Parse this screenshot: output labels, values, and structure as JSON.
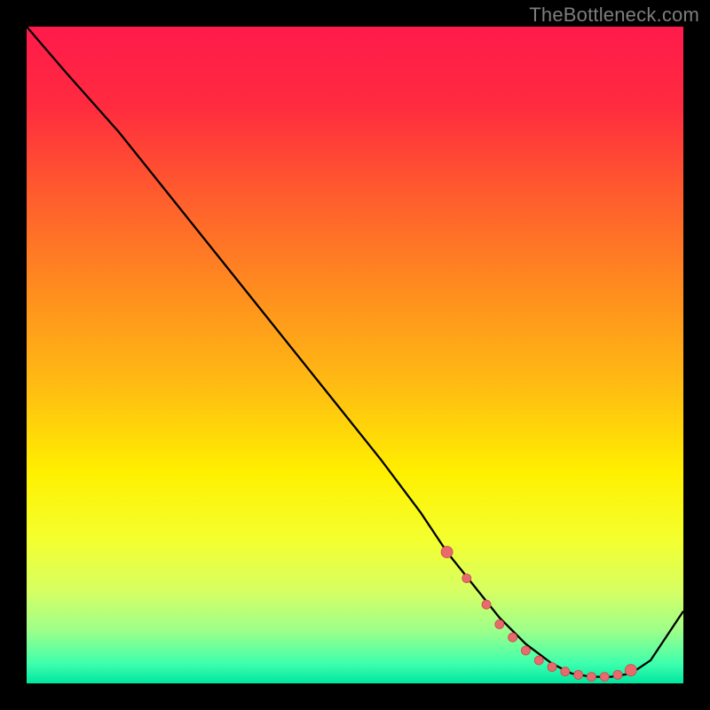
{
  "attribution": "TheBottleneck.com",
  "colors": {
    "frame_bg": "#000000",
    "attribution_text": "#7d7d7d",
    "gradient_stops": [
      {
        "offset": 0.0,
        "color": "#ff1a4b"
      },
      {
        "offset": 0.12,
        "color": "#ff2b3f"
      },
      {
        "offset": 0.25,
        "color": "#ff5a2e"
      },
      {
        "offset": 0.4,
        "color": "#ff8c1f"
      },
      {
        "offset": 0.55,
        "color": "#ffbd12"
      },
      {
        "offset": 0.68,
        "color": "#fff000"
      },
      {
        "offset": 0.78,
        "color": "#f4ff2e"
      },
      {
        "offset": 0.86,
        "color": "#d6ff63"
      },
      {
        "offset": 0.92,
        "color": "#9dff8a"
      },
      {
        "offset": 0.97,
        "color": "#3dffad"
      },
      {
        "offset": 1.0,
        "color": "#00e6a0"
      }
    ],
    "curve": "#000000",
    "marker_fill": "#e96a6d",
    "marker_stroke": "#c94a50"
  },
  "chart_data": {
    "type": "line",
    "title": "",
    "xlabel": "",
    "ylabel": "",
    "xlim": [
      0,
      100
    ],
    "ylim": [
      0,
      100
    ],
    "series": [
      {
        "name": "curve",
        "x": [
          0,
          6,
          14,
          22,
          30,
          38,
          46,
          54,
          60,
          64,
          68,
          72,
          76,
          80,
          83,
          86,
          89,
          92,
          95,
          100
        ],
        "y": [
          100,
          93,
          84,
          74,
          64,
          54,
          44,
          34,
          26,
          20,
          15,
          10,
          6,
          3,
          1.5,
          1,
          1,
          1.5,
          3.5,
          11
        ]
      }
    ],
    "markers": {
      "name": "highlight",
      "x": [
        64,
        67,
        70,
        72,
        74,
        76,
        78,
        80,
        82,
        84,
        86,
        88,
        90,
        92
      ],
      "y": [
        20,
        16,
        12,
        9,
        7,
        5,
        3.5,
        2.5,
        1.8,
        1.3,
        1,
        1,
        1.3,
        2
      ]
    }
  }
}
